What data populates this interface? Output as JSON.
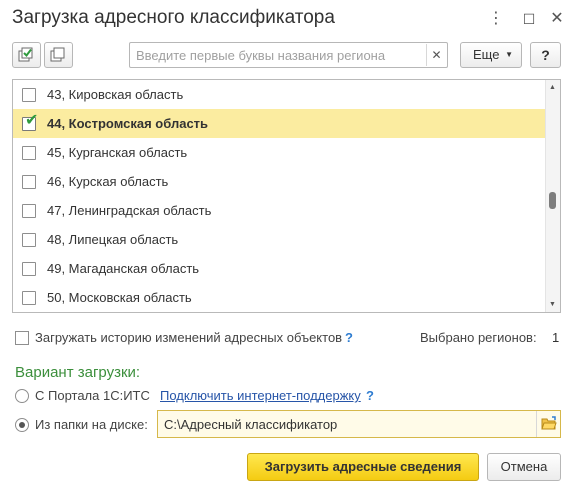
{
  "window": {
    "title": "Загрузка адресного классификатора",
    "menu_icon": "⋮",
    "maximize_icon": "☐",
    "close_icon": "✕"
  },
  "toolbar": {
    "check_all_icon": "check-all-icon",
    "uncheck_all_icon": "uncheck-all-icon",
    "search_placeholder": "Введите первые буквы названия региона",
    "search_value": "",
    "search_clear": "✕",
    "more_label": "Еще",
    "more_arrow": "▼",
    "help_label": "?"
  },
  "regions": [
    {
      "label": "43, Кировская область",
      "checked": false,
      "selected": false
    },
    {
      "label": "44, Костромская область",
      "checked": true,
      "selected": true
    },
    {
      "label": "45, Курганская область",
      "checked": false,
      "selected": false
    },
    {
      "label": "46, Курская область",
      "checked": false,
      "selected": false
    },
    {
      "label": "47, Ленинградская область",
      "checked": false,
      "selected": false
    },
    {
      "label": "48, Липецкая область",
      "checked": false,
      "selected": false
    },
    {
      "label": "49, Магаданская область",
      "checked": false,
      "selected": false
    },
    {
      "label": "50, Московская область",
      "checked": false,
      "selected": false
    }
  ],
  "scroll": {
    "up": "▲",
    "down": "▼"
  },
  "history": {
    "label": "Загружать историю изменений адресных объектов",
    "help": "?",
    "checked": false
  },
  "selected_count": {
    "label": "Выбрано регионов:",
    "value": "1"
  },
  "variant": {
    "title": "Вариант загрузки:",
    "portal_label": "С Портала 1С:ИТС",
    "portal_link": "Подключить интернет-поддержку",
    "portal_help": "?",
    "disk_label": "Из папки на диске:",
    "disk_path": "C:\\Адресный классификатор",
    "selected": "disk"
  },
  "buttons": {
    "load": "Загрузить адресные сведения",
    "cancel": "Отмена"
  },
  "colors": {
    "selected_row": "#fbeca0",
    "accent_button": "#f4cb12",
    "section_title": "#3c8f3c",
    "link": "#2755a8",
    "checkmark": "#2f9a3d"
  }
}
